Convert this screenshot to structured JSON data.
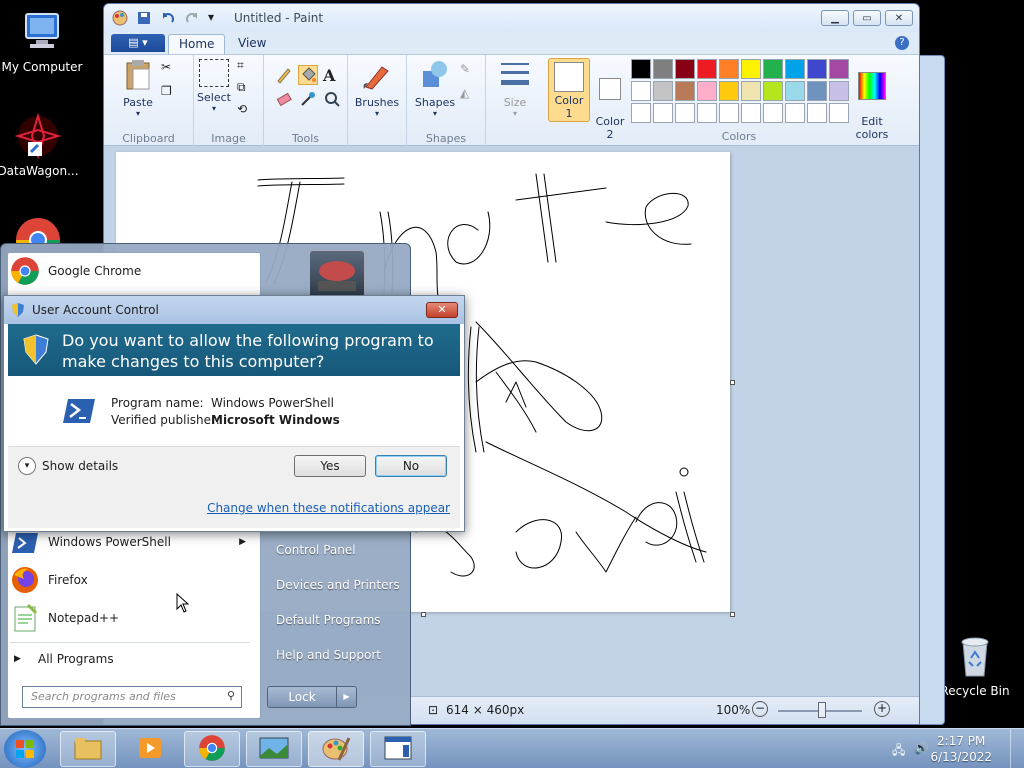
{
  "desktop": {
    "icons": [
      {
        "label": "My Computer"
      },
      {
        "label": "DataWagon..."
      },
      {
        "label": "Recycle Bin"
      }
    ]
  },
  "paint": {
    "title": "Untitled - Paint",
    "tabs": [
      "Home",
      "View"
    ],
    "groups": {
      "clipboard": "Clipboard",
      "image": "Image",
      "tools": "Tools",
      "shapes": "Shapes",
      "colors": "Colors"
    },
    "buttons": {
      "paste": "Paste",
      "select": "Select",
      "brushes": "Brushes",
      "shapes": "Shapes",
      "size": "Size",
      "color1": "Color\n1",
      "color2": "Color\n2",
      "edit_colors": "Edit\ncolors"
    },
    "palette": [
      "#000000",
      "#7f7f7f",
      "#880015",
      "#ed1c24",
      "#ff7f27",
      "#fff200",
      "#22b14c",
      "#00a2e8",
      "#3f48cc",
      "#a349a4",
      "#ffffff",
      "#c3c3c3",
      "#b97a57",
      "#ffaec9",
      "#ffc90e",
      "#efe4b0",
      "#b5e61d",
      "#99d9ea",
      "#7092be",
      "#c8bfe7",
      "#ffffff",
      "#ffffff",
      "#ffffff",
      "#ffffff",
      "#ffffff",
      "#ffffff",
      "#ffffff",
      "#ffffff",
      "#ffffff",
      "#ffffff"
    ],
    "status": {
      "dimensions": "614 × 460px",
      "zoom": "100%"
    }
  },
  "startmenu": {
    "pinned": [
      "Google Chrome"
    ],
    "recent": [
      "Windows PowerShell",
      "Firefox",
      "Notepad++"
    ],
    "all_programs": "All Programs",
    "search_placeholder": "Search programs and files",
    "right": [
      "Control Panel",
      "Devices and Printers",
      "Default Programs",
      "Help and Support"
    ],
    "lock": "Lock"
  },
  "uac": {
    "title": "User Account Control",
    "question": "Do you want to allow the following program to make changes to this computer?",
    "program_label": "Program name:",
    "program_value": "Windows PowerShell",
    "publisher_label": "Verified publisher:",
    "publisher_value": "Microsoft Windows",
    "show_details": "Show details",
    "yes": "Yes",
    "no": "No",
    "link": "Change when these notifications appear"
  },
  "taskbar": {
    "time": "2:17 PM",
    "date": "6/13/2022"
  }
}
